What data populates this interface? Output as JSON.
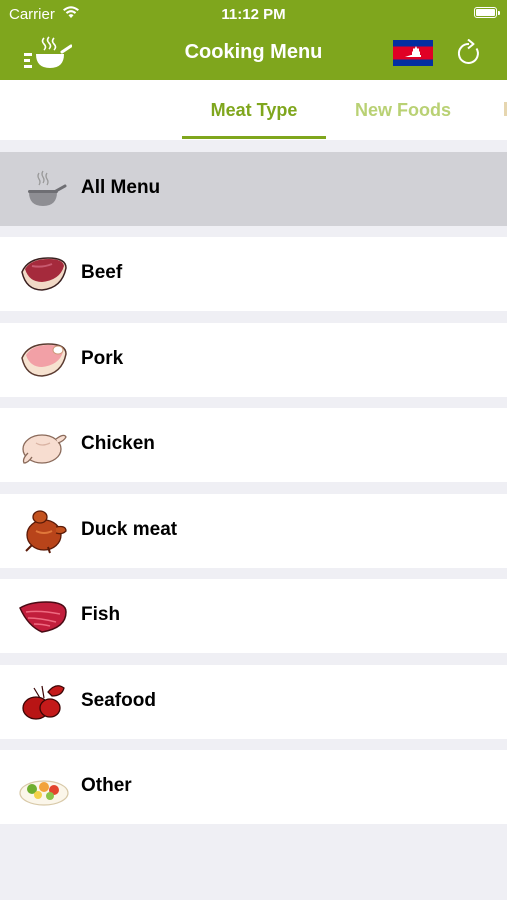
{
  "status_bar": {
    "carrier": "Carrier",
    "time": "11:12 PM"
  },
  "nav": {
    "title": "Cooking Menu",
    "logo_icon": "cooking-pot-logo-icon",
    "flag_icon": "cambodia-flag-icon",
    "refresh_icon": "refresh-icon"
  },
  "tabs": [
    {
      "label": "Meat Type",
      "active": true
    },
    {
      "label": "New Foods",
      "active": false
    }
  ],
  "menu": [
    {
      "label": "All Menu",
      "icon": "cooking-pot-icon",
      "selected": true
    },
    {
      "label": "Beef",
      "icon": "beef-icon",
      "selected": false
    },
    {
      "label": "Pork",
      "icon": "pork-icon",
      "selected": false
    },
    {
      "label": "Chicken",
      "icon": "chicken-icon",
      "selected": false
    },
    {
      "label": "Duck meat",
      "icon": "duck-icon",
      "selected": false
    },
    {
      "label": "Fish",
      "icon": "fish-icon",
      "selected": false
    },
    {
      "label": "Seafood",
      "icon": "lobster-icon",
      "selected": false
    },
    {
      "label": "Other",
      "icon": "salad-icon",
      "selected": false
    }
  ],
  "colors": {
    "brand_green": "#7fa61d",
    "inactive_tab": "#b9d174",
    "selected_row": "#d1d1d6",
    "background": "#efeff4"
  }
}
